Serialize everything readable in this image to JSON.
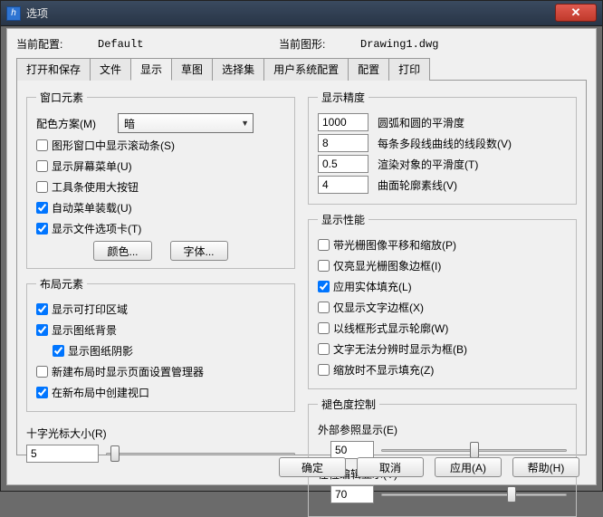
{
  "window": {
    "title": "选项"
  },
  "header": {
    "config_label": "当前配置:",
    "config_value": "Default",
    "drawing_label": "当前图形:",
    "drawing_value": "Drawing1.dwg"
  },
  "tabs": [
    "打开和保存",
    "文件",
    "显示",
    "草图",
    "选择集",
    "用户系统配置",
    "配置",
    "打印"
  ],
  "active_tab": 2,
  "left": {
    "group_window": {
      "legend": "窗口元素",
      "scheme_label": "配色方案(M)",
      "scheme_value": "暗",
      "scroll": "图形窗口中显示滚动条(S)",
      "screen_menu": "显示屏幕菜单(U)",
      "big_buttons": "工具条使用大按钮",
      "auto_menu": "自动菜单装载(U)",
      "file_tabs": "显示文件选项卡(T)",
      "color_btn": "颜色...",
      "font_btn": "字体..."
    },
    "group_layout": {
      "legend": "布局元素",
      "print_area": "显示可打印区域",
      "paper_bg": "显示图纸背景",
      "paper_shadow": "显示图纸阴影",
      "page_setup": "新建布局时显示页面设置管理器",
      "viewport": "在新布局中创建视口"
    },
    "crosshair": {
      "label": "十字光标大小(R)",
      "value": "5"
    }
  },
  "right": {
    "group_precision": {
      "legend": "显示精度",
      "rows": [
        {
          "value": "1000",
          "label": "圆弧和圆的平滑度"
        },
        {
          "value": "8",
          "label": "每条多段线曲线的线段数(V)"
        },
        {
          "value": "0.5",
          "label": "渲染对象的平滑度(T)"
        },
        {
          "value": "4",
          "label": "曲面轮廓素线(V)"
        }
      ]
    },
    "group_perf": {
      "legend": "显示性能",
      "raster_pan": "带光栅图像平移和缩放(P)",
      "highlight_frame": "仅亮显光栅图象边框(I)",
      "solid_fill": "应用实体填充(L)",
      "text_frame": "仅显示文字边框(X)",
      "wire_silh": "以线框形式显示轮廓(W)",
      "text_box": "文字无法分辨时显示为框(B)",
      "zoom_no_fill": "缩放时不显示填充(Z)"
    },
    "group_fade": {
      "legend": "褪色度控制",
      "xref_label": "外部参照显示(E)",
      "xref_value": "50",
      "inplace_label": "在位编辑显示(Y)",
      "inplace_value": "70"
    }
  },
  "buttons": {
    "ok": "确定",
    "cancel": "取消",
    "apply": "应用(A)",
    "help": "帮助(H)"
  },
  "checked": {
    "scroll": false,
    "screen_menu": false,
    "big_buttons": false,
    "auto_menu": true,
    "file_tabs": true,
    "print_area": true,
    "paper_bg": true,
    "paper_shadow": true,
    "page_setup": false,
    "viewport": true,
    "raster_pan": false,
    "highlight_frame": false,
    "solid_fill": true,
    "text_frame": false,
    "wire_silh": false,
    "text_box": false,
    "zoom_no_fill": false
  },
  "sliders": {
    "crosshair_pct": 5,
    "xref_pct": 50,
    "inplace_pct": 70
  }
}
